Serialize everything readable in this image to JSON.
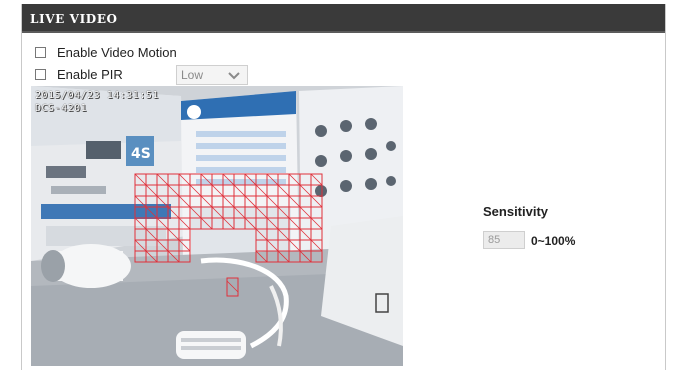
{
  "section": {
    "title": "LIVE VIDEO"
  },
  "options": {
    "video_motion_label": "Enable Video Motion",
    "pir_label": "Enable PIR",
    "pir_level": "Low"
  },
  "video": {
    "timestamp": "2015/04/23 14:31:51",
    "camera_name": "DCS-4201"
  },
  "sensitivity": {
    "title": "Sensitivity",
    "value": "85",
    "range_label": "0~100%"
  },
  "colors": {
    "header_bg": "#3a3a3a",
    "motion_grid": "#e0303a"
  },
  "icons": {
    "dropdown": "chevron-down-icon"
  }
}
